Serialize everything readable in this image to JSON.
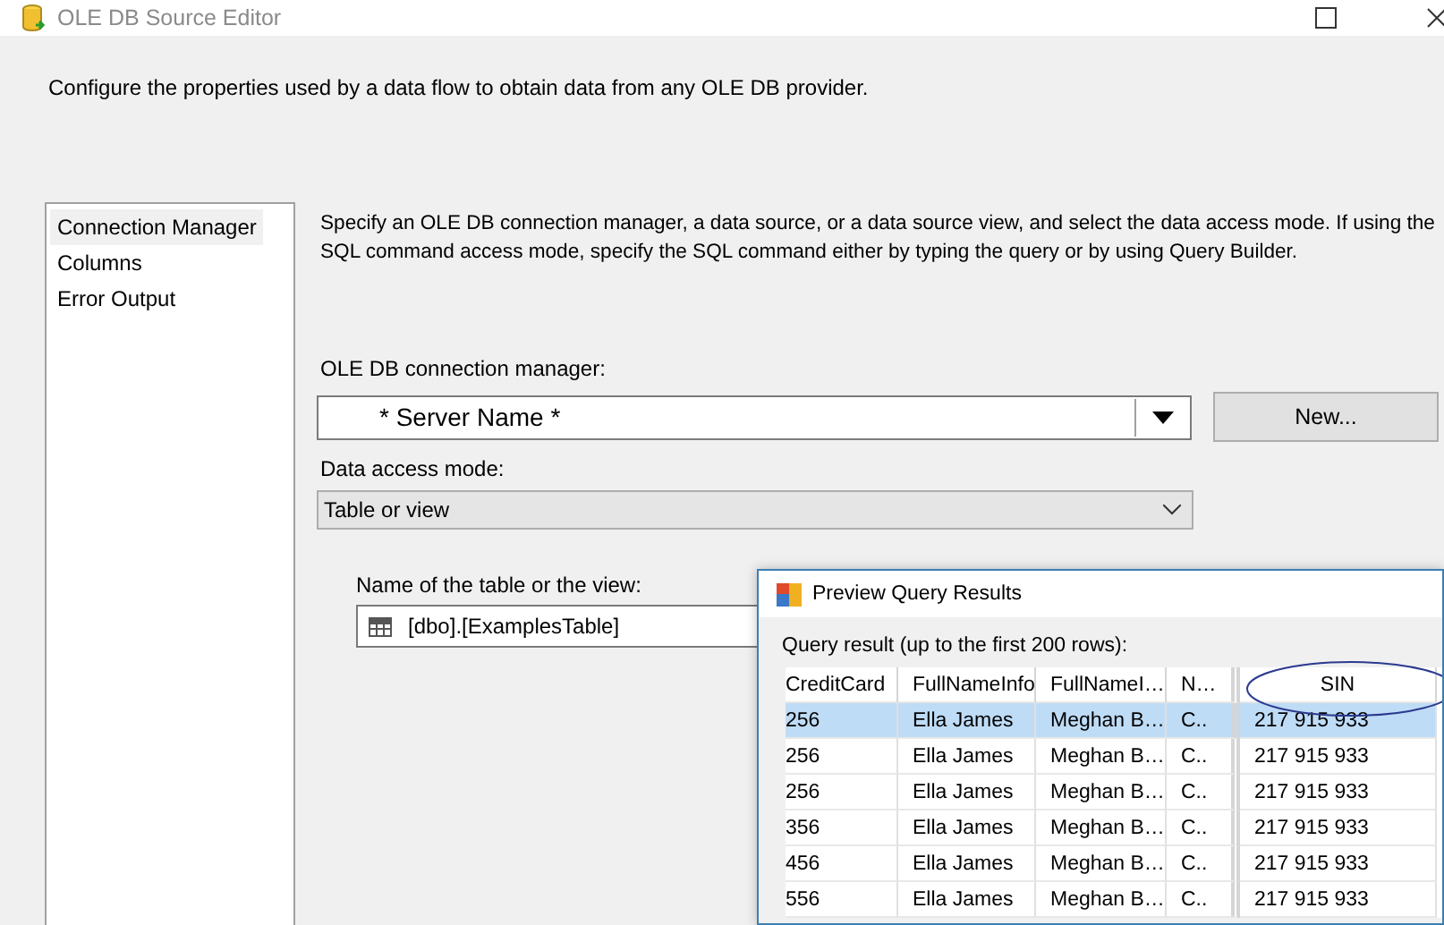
{
  "window": {
    "title": "OLE DB Source Editor"
  },
  "description": "Configure the properties used by a data flow to obtain data from any OLE DB provider.",
  "sidebar": {
    "items": [
      {
        "label": "Connection Manager",
        "selected": true
      },
      {
        "label": "Columns",
        "selected": false
      },
      {
        "label": "Error Output",
        "selected": false
      }
    ]
  },
  "instructions": "Specify an OLE DB connection manager, a data source, or a data source view, and select the data access mode. If using the SQL command access mode, specify the SQL command either by typing the query or by using Query Builder.",
  "connection_manager": {
    "label": "OLE DB connection manager:",
    "value": "* Server Name *",
    "new_button": "New..."
  },
  "data_access_mode": {
    "label": "Data access mode:",
    "value": "Table or view"
  },
  "table_name": {
    "label": "Name of the table or the view:",
    "value": "[dbo].[ExamplesTable]"
  },
  "preview": {
    "title": "Preview Query Results",
    "caption": "Query result (up to the first 200 rows):",
    "columns": [
      "CreditCard",
      "FullNameInfo",
      "FullNameI…",
      "N…",
      "SIN"
    ],
    "rows": [
      {
        "cells": [
          "256",
          "Ella James",
          "Meghan B…",
          "C..",
          "217 915 933"
        ],
        "selected": true
      },
      {
        "cells": [
          "256",
          "Ella James",
          "Meghan B…",
          "C..",
          "217 915 933"
        ],
        "selected": false
      },
      {
        "cells": [
          "256",
          "Ella James",
          "Meghan B…",
          "C..",
          "217 915 933"
        ],
        "selected": false
      },
      {
        "cells": [
          "356",
          "Ella James",
          "Meghan B…",
          "C..",
          "217 915 933"
        ],
        "selected": false
      },
      {
        "cells": [
          "456",
          "Ella James",
          "Meghan B…",
          "C..",
          "217 915 933"
        ],
        "selected": false
      },
      {
        "cells": [
          "556",
          "Ella James",
          "Meghan B…",
          "C..",
          "217 915 933"
        ],
        "selected": false
      }
    ]
  }
}
